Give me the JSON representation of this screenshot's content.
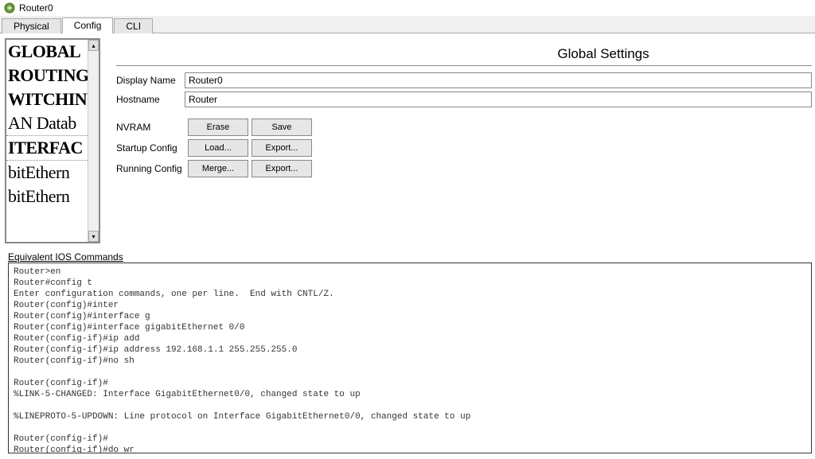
{
  "window": {
    "title": "Router0"
  },
  "tabs": {
    "physical": "Physical",
    "config": "Config",
    "cli": "CLI"
  },
  "sidebar": {
    "items": [
      {
        "label": "GLOBAL"
      },
      {
        "label": "ROUTING"
      },
      {
        "label": "WITCHIN"
      },
      {
        "label": "AN Datab"
      },
      {
        "label": "ITERFAC"
      },
      {
        "label": "bitEthern"
      },
      {
        "label": "bitEthern"
      }
    ]
  },
  "settings": {
    "heading": "Global Settings",
    "displayNameLabel": "Display Name",
    "displayNameValue": "Router0",
    "hostnameLabel": "Hostname",
    "hostnameValue": "Router",
    "nvramLabel": "NVRAM",
    "eraseBtn": "Erase",
    "saveBtn": "Save",
    "startupLabel": "Startup Config",
    "loadBtn": "Load...",
    "exportBtn": "Export...",
    "runningLabel": "Running Config",
    "mergeBtn": "Merge..."
  },
  "commands": {
    "label": "Equivalent IOS Commands",
    "text": "Router>en\nRouter#config t\nEnter configuration commands, one per line.  End with CNTL/Z.\nRouter(config)#inter\nRouter(config)#interface g\nRouter(config)#interface gigabitEthernet 0/0\nRouter(config-if)#ip add\nRouter(config-if)#ip address 192.168.1.1 255.255.255.0\nRouter(config-if)#no sh\n\nRouter(config-if)#\n%LINK-5-CHANGED: Interface GigabitEthernet0/0, changed state to up\n\n%LINEPROTO-5-UPDOWN: Line protocol on Interface GigabitEthernet0/0, changed state to up\n\nRouter(config-if)#\nRouter(config-if)#do wr\nBuilding configuration...\n[OK]\nRouter(config-if)#"
  }
}
